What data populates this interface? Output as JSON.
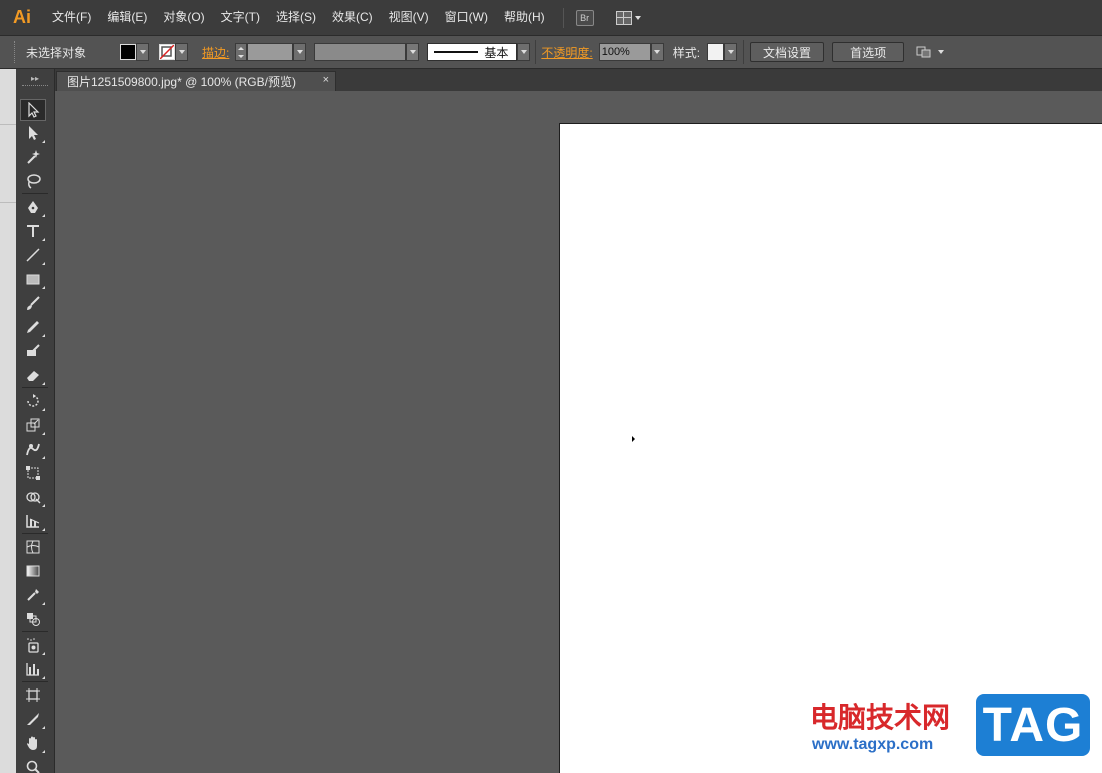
{
  "app": {
    "logo": "Ai",
    "br_label": "Br"
  },
  "menu": {
    "items": [
      "文件(F)",
      "编辑(E)",
      "对象(O)",
      "文字(T)",
      "选择(S)",
      "效果(C)",
      "视图(V)",
      "窗口(W)",
      "帮助(H)"
    ]
  },
  "control": {
    "selection_status": "未选择对象",
    "stroke_label": "描边:",
    "stroke_style": "基本",
    "opacity_label": "不透明度:",
    "opacity_value": "100%",
    "style_label": "样式:",
    "doc_setup": "文档设置",
    "preferences": "首选项"
  },
  "document": {
    "tab_title": "图片1251509800.jpg* @ 100% (RGB/预览)",
    "close_glyph": "×"
  },
  "tools": [
    "selection-tool",
    "direct-selection-tool",
    "magic-wand-tool",
    "lasso-tool",
    "pen-tool",
    "type-tool",
    "line-segment-tool",
    "rectangle-tool",
    "paintbrush-tool",
    "pencil-tool",
    "blob-brush-tool",
    "eraser-tool",
    "rotate-tool",
    "scale-tool",
    "warp-tool",
    "free-transform-tool",
    "shape-builder-tool",
    "perspective-grid-tool",
    "mesh-tool",
    "gradient-tool",
    "eyedropper-tool",
    "blend-tool",
    "symbol-sprayer-tool",
    "column-graph-tool",
    "artboard-tool",
    "slice-tool",
    "hand-tool",
    "zoom-tool"
  ],
  "watermark": {
    "cn_text": "电脑技术网",
    "url": "www.tagxp.com",
    "badge": "TAG"
  },
  "colors": {
    "accent": "#f29a24",
    "artboard": "#ffffff",
    "canvas": "#5a5a5a"
  }
}
